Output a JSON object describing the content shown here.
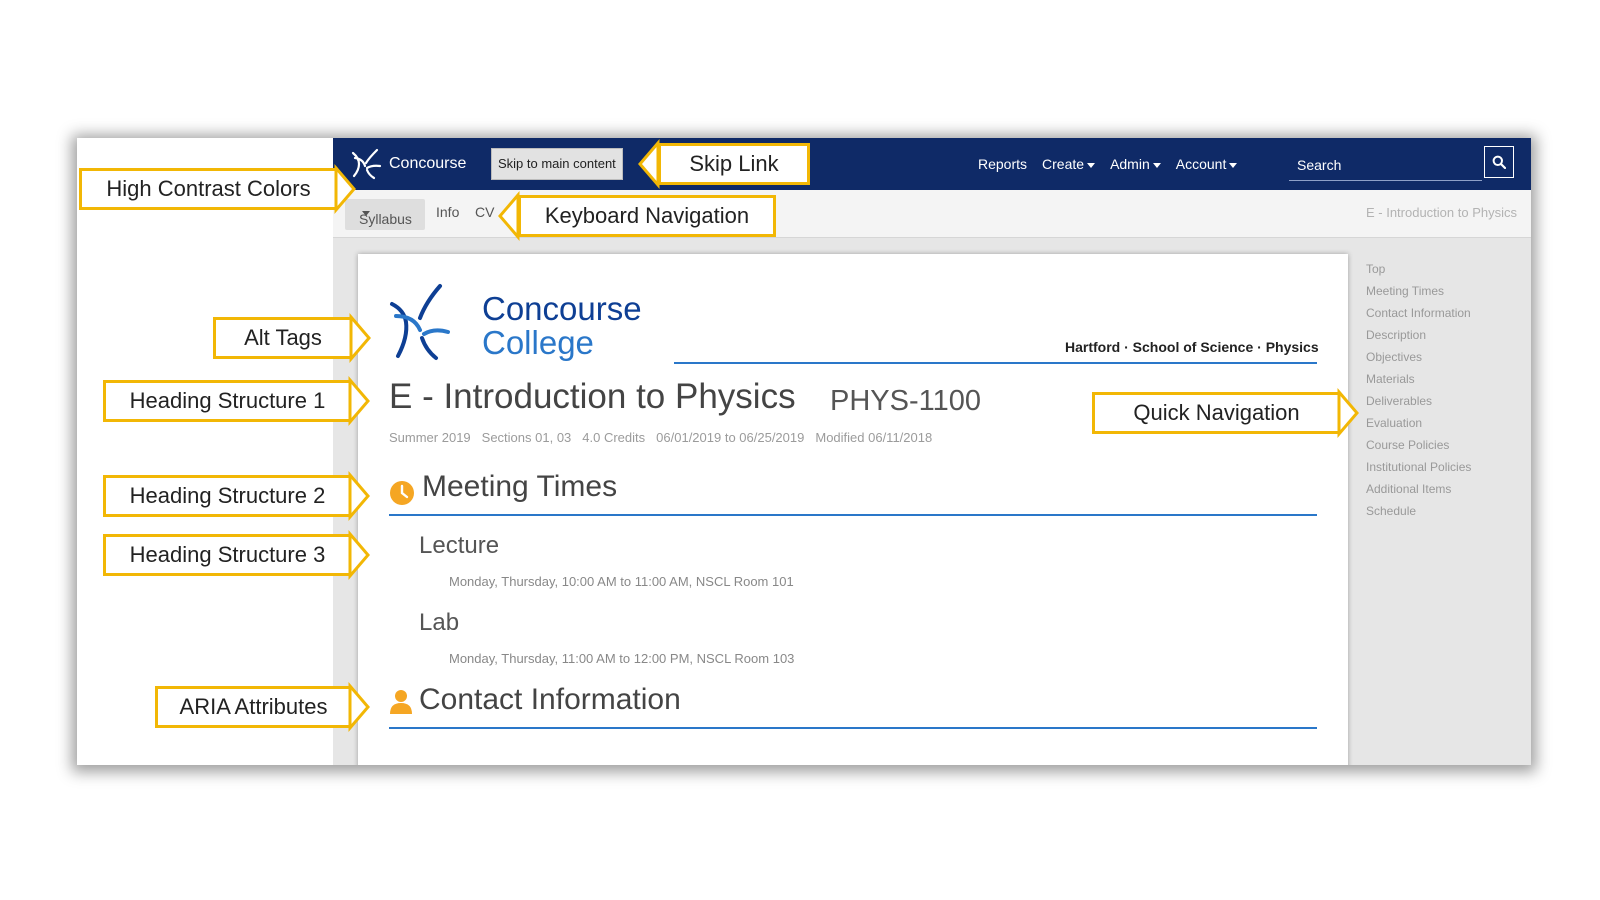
{
  "topbar": {
    "brand": "Concourse",
    "skip_link": "Skip to main content",
    "menu": [
      {
        "label": "Reports",
        "dropdown": false
      },
      {
        "label": "Create",
        "dropdown": true
      },
      {
        "label": "Admin",
        "dropdown": true
      },
      {
        "label": "Account",
        "dropdown": true
      }
    ],
    "search_placeholder": "Search",
    "search_icon": "search-icon"
  },
  "subnav": {
    "syllabus": "Syllabus",
    "info": "Info",
    "cv": "CV",
    "breadcrumb": "E - Introduction to Physics"
  },
  "course": {
    "college_line1": "Concourse",
    "college_line2": "College",
    "department": "Hartford · School of Science · Physics",
    "title": "E - Introduction to Physics",
    "code": "PHYS-1100",
    "meta": [
      "Summer 2019",
      "Sections 01, 03",
      "4.0 Credits",
      "06/01/2019 to 06/25/2019",
      "Modified 06/11/2018"
    ]
  },
  "meeting_times": {
    "heading": "Meeting Times",
    "icon": "clock-icon",
    "lecture_heading": "Lecture",
    "lecture_detail": "Monday, Thursday, 10:00 AM to 11:00 AM, NSCL Room 101",
    "lab_heading": "Lab",
    "lab_detail": "Monday, Thursday, 11:00 AM to 12:00 PM, NSCL Room 103"
  },
  "contact": {
    "heading": "Contact Information",
    "icon": "user-icon"
  },
  "quick_nav": [
    "Top",
    "Meeting Times",
    "Contact Information",
    "Description",
    "Objectives",
    "Materials",
    "Deliverables",
    "Evaluation",
    "Course Policies",
    "Institutional Policies",
    "Additional Items",
    "Schedule"
  ],
  "annotations": {
    "high_contrast": "High Contrast Colors",
    "skip_link": "Skip Link",
    "keyboard_nav": "Keyboard Navigation",
    "alt_tags": "Alt Tags",
    "heading1": "Heading Structure 1",
    "heading2": "Heading Structure 2",
    "heading3": "Heading Structure 3",
    "aria": "ARIA Attributes",
    "quick_nav": "Quick Navigation"
  },
  "colors": {
    "navbar": "#0f2a67",
    "accent_blue": "#2a77c9",
    "icon_orange": "#f5a623",
    "callout_border": "#f2b705"
  }
}
